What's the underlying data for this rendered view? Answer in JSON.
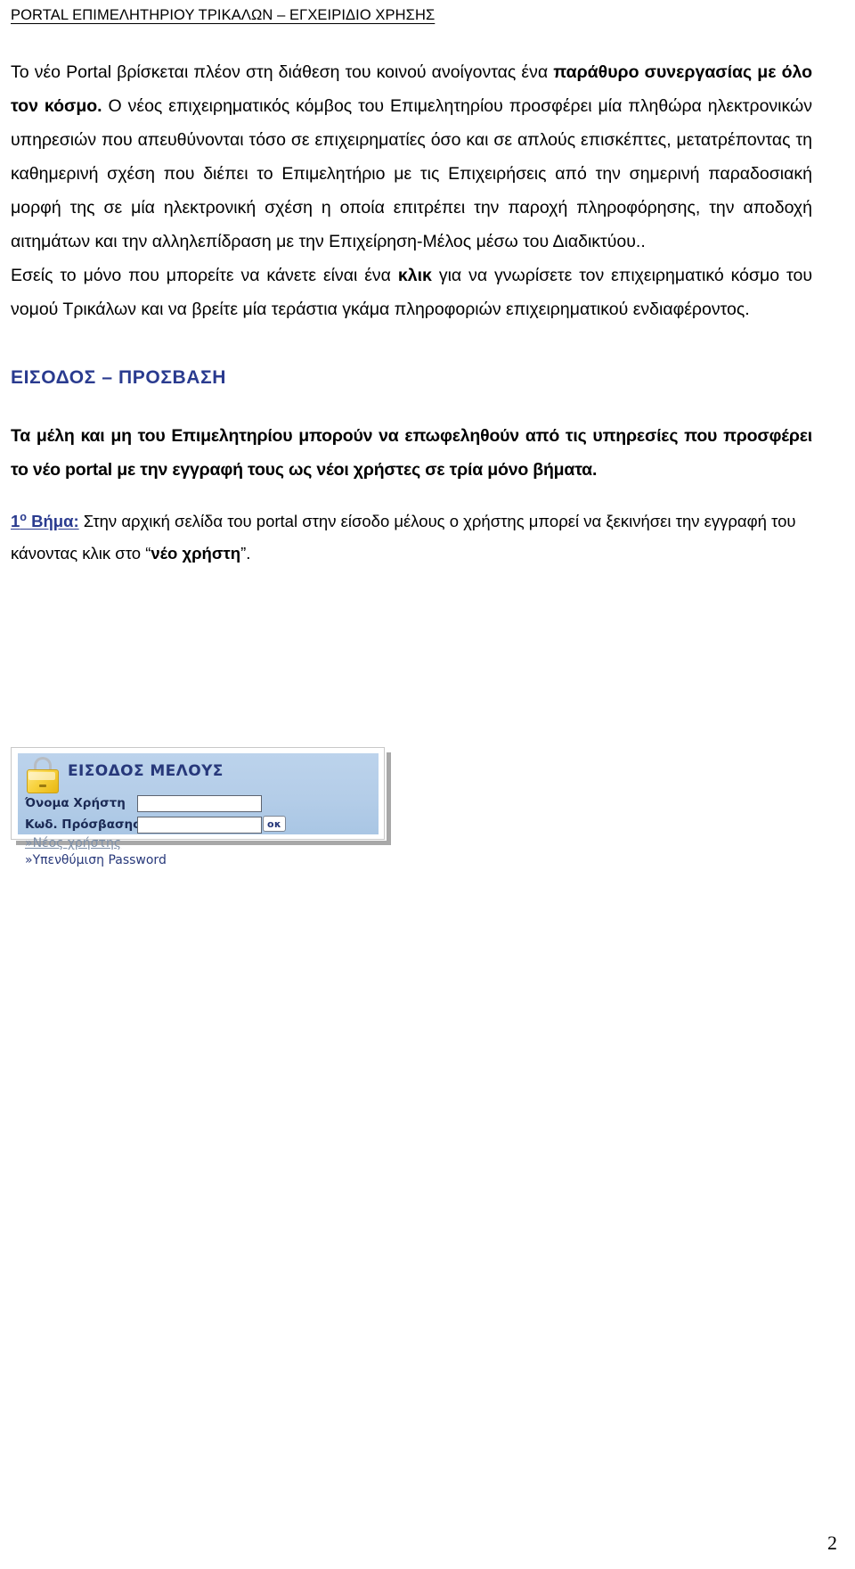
{
  "document": {
    "running_header": "PORTAL ΕΠΙΜΕΛΗΤΗΡΙΟΥ ΤΡΙΚΑΛΩΝ – ΕΓΧΕΙΡΙΔΙΟ ΧΡΗΣΗΣ",
    "page_number": "2"
  },
  "body": {
    "paragraph_1": {
      "part_1": "Το νέο Portal βρίσκεται πλέον στη διάθεση του κοινού ανοίγοντας ένα ",
      "bold_1": "παράθυρο συνεργασίας με όλο τον κόσμο.",
      "part_2": " Ο νέος επιχειρηματικός κόμβος του Επιμελητηρίου προσφέρει μία πληθώρα ηλεκτρονικών υπηρεσιών που απευθύνονται τόσο σε επιχειρηματίες όσο και σε απλούς επισκέπτες, μετατρέποντας τη καθημερινή σχέση που διέπει το Επιμελητήριο με τις Επιχειρήσεις από την σημερινή παραδοσιακή μορφή της σε μία ηλεκτρονική σχέση η οποία επιτρέπει την παροχή πληροφόρησης, την αποδοχή αιτημάτων και την αλληλεπίδραση με την Επιχείρηση-Μέλος μέσω του Διαδικτύου.."
    },
    "paragraph_2": {
      "part_1": "Εσείς το μόνο που μπορείτε να κάνετε είναι ένα ",
      "bold_1": "κλικ",
      "part_2": " για να γνωρίσετε τον επιχειρηματικό κόσμο του νομού Τρικάλων και να βρείτε μία τεράστια γκάμα πληροφοριών επιχειρηματικού ενδιαφέροντος."
    },
    "section_heading": "ΕΙΣΟΔΟΣ – ΠΡΟΣΒΑΣΗ",
    "paragraph_3": "Τα μέλη και μη του Επιμελητηρίου μπορούν να επωφεληθούν από τις υπηρεσίες που προσφέρει το νέο portal με την εγγραφή τους ως νέοι χρήστες σε τρία μόνο βήματα.",
    "step_1": {
      "label": "1",
      "label_sup": "ο",
      "label_rest": " Βήμα:",
      "text_1": " Στην αρχική  σελίδα του portal στην είσοδο μέλους ο χρήστης μπορεί να ξεκινήσει την εγγραφή του κάνοντας κλικ στο ",
      "quote_open": "“",
      "bold_1": "νέο χρήστη",
      "quote_close": "”",
      "text_2": "."
    }
  },
  "login_widget": {
    "icon": "padlock-icon",
    "title": "ΕΙΣΟΔΟΣ ΜΕΛΟΥΣ",
    "username_label": "Όνομα Χρήστη",
    "username_value": "",
    "password_label": "Κωδ. Πρόσβασης",
    "password_value": "",
    "ok_label": "οκ",
    "link_new_user": "»Νέος χρήστης",
    "link_remind_password": "»Υπενθύμιση Password"
  },
  "colors": {
    "heading_blue": "#2a3b8f",
    "panel_blue": "#b4cde8",
    "lock_yellow": "#f7d23e",
    "link_navy": "#27387a"
  }
}
